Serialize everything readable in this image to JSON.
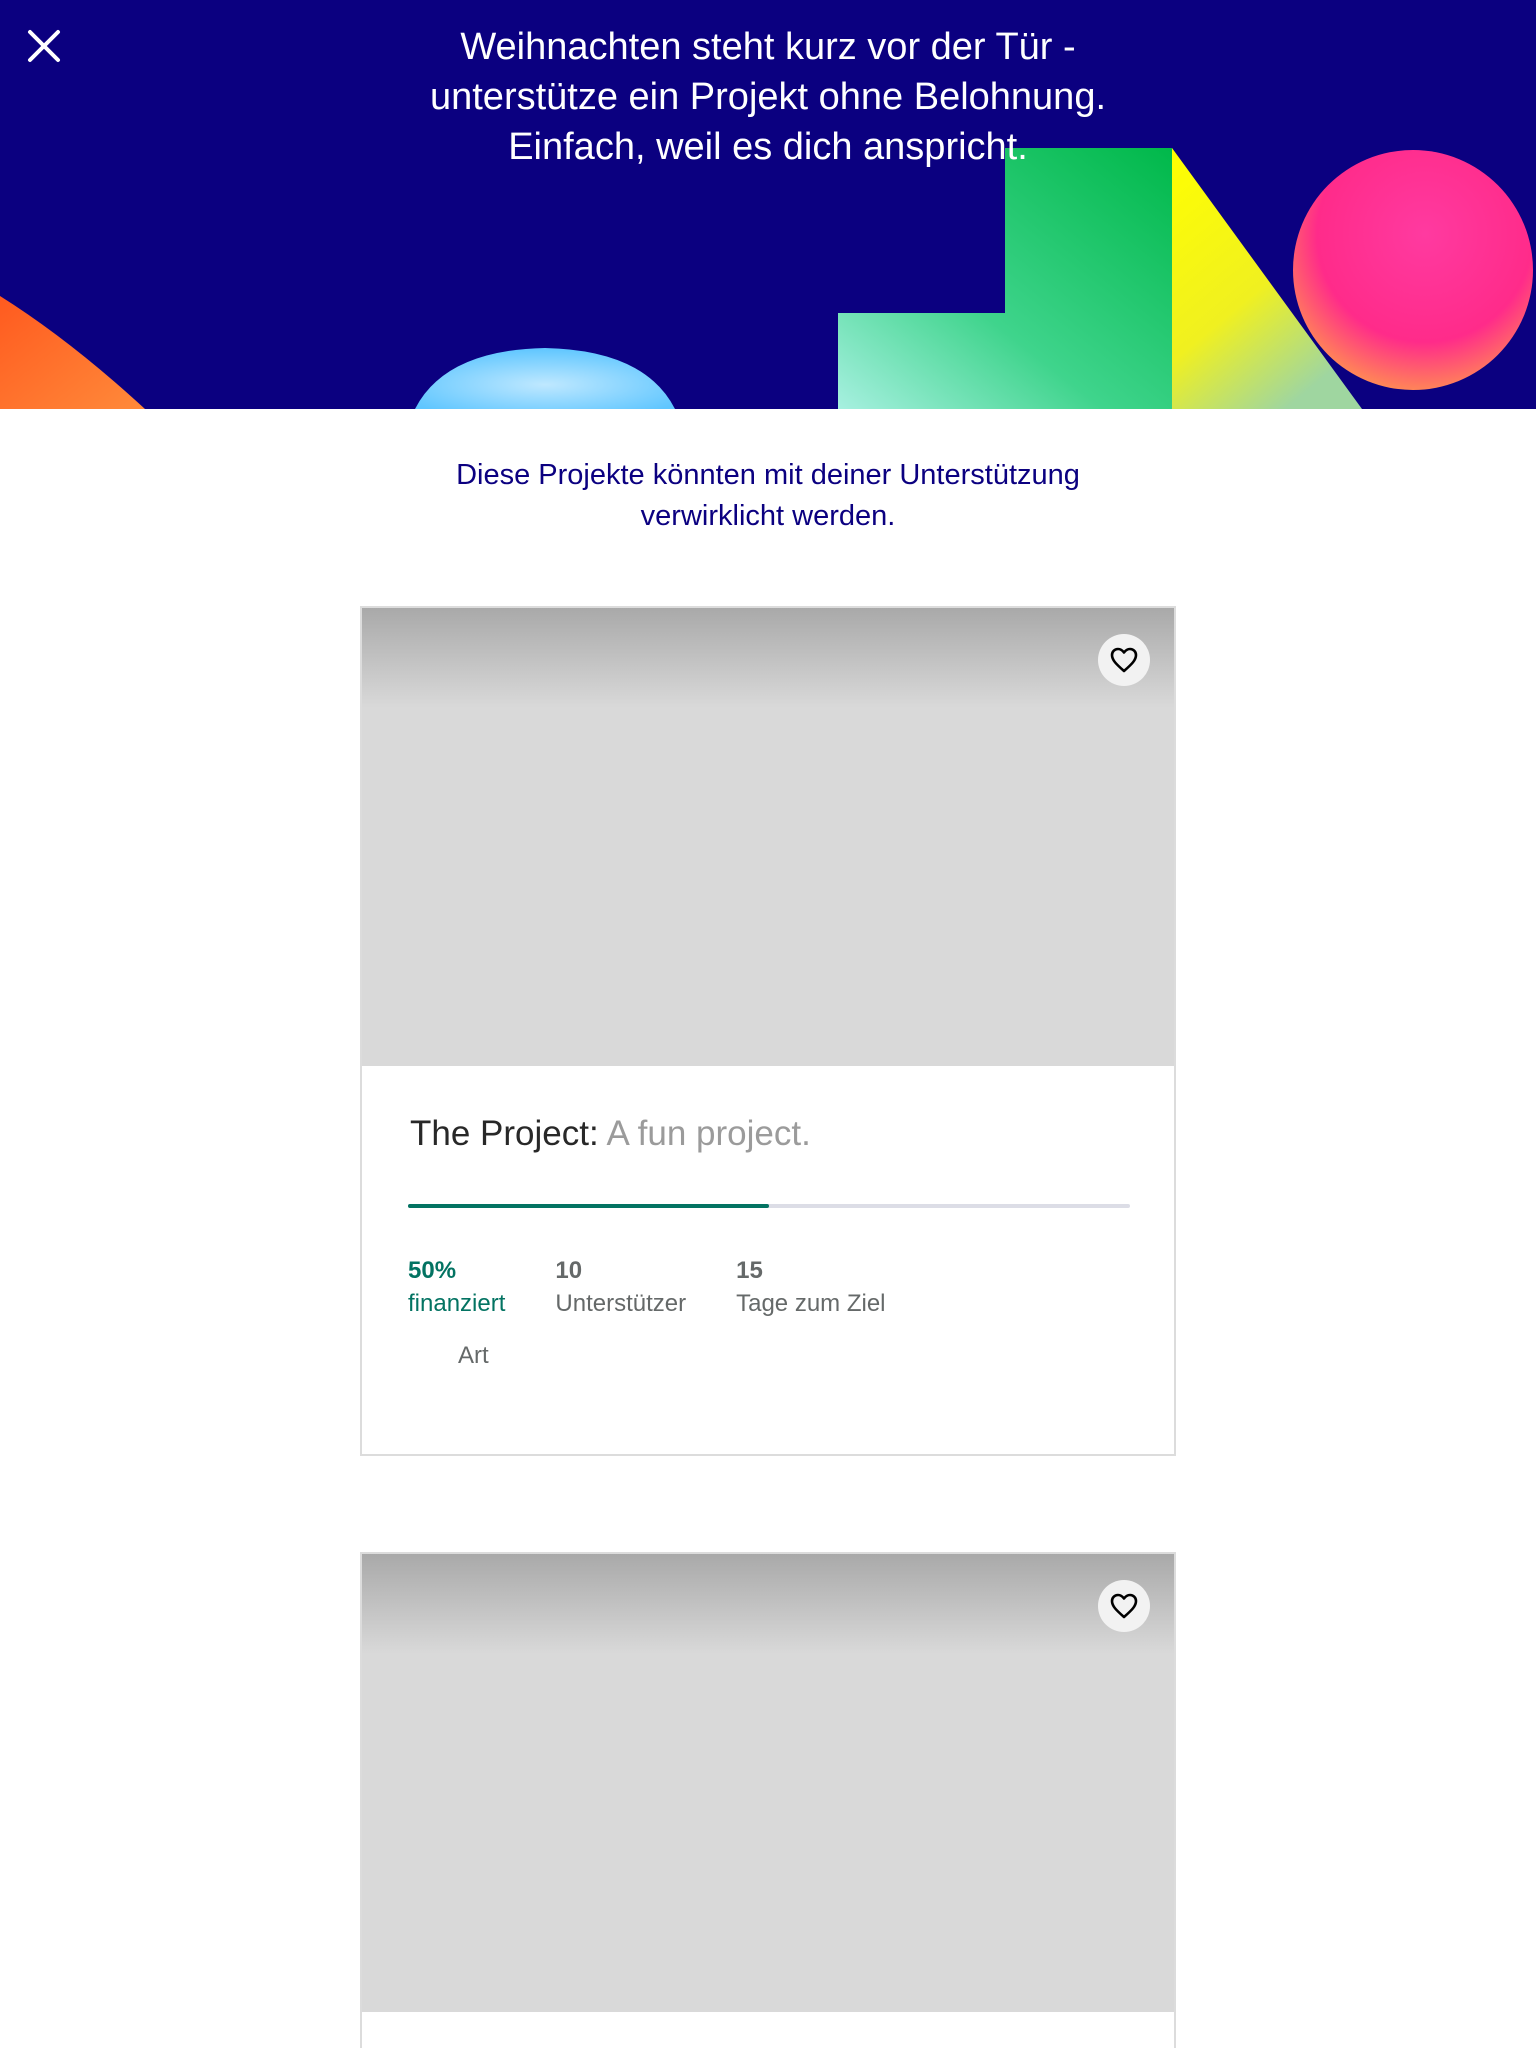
{
  "banner": {
    "title_lines": [
      "Weihnachten steht kurz vor der Tür -",
      "unterstütze ein Projekt ohne Belohnung.",
      "Einfach, weil es dich anspricht."
    ],
    "close_icon": "close-icon",
    "background_color": "#0b0080"
  },
  "section": {
    "subtitle_lines": [
      "Diese Projekte könnten mit deiner Unterstützung",
      "verwirklicht werden."
    ]
  },
  "projects": [
    {
      "name": "The Project:",
      "blurb": "A fun project.",
      "funded_percent": 50,
      "funded_value": "50%",
      "funded_label": "finanziert",
      "backers_value": "10",
      "backers_label": "Unterstützer",
      "days_value": "15",
      "days_label": "Tage zum Ziel",
      "category": "Art",
      "save_icon": "heart-icon"
    },
    {
      "save_icon": "heart-icon"
    }
  ],
  "colors": {
    "accent_green": "#037362",
    "title_blue": "#0b0080",
    "muted_text": "#656969"
  }
}
